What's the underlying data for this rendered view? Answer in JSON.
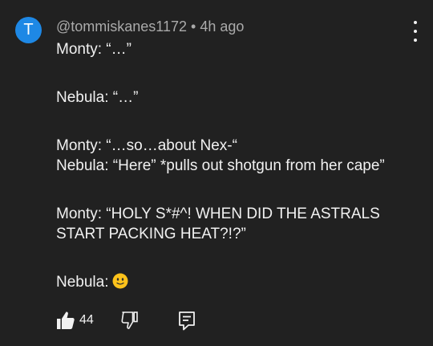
{
  "comment": {
    "avatar_letter": "T",
    "avatar_color": "#1e88e5",
    "author": "@tommiskanes1172",
    "separator": "•",
    "timestamp": "4h ago",
    "menu_icon": "more-vert-icon",
    "lines": [
      "Monty: “…”",
      "Nebula: “…”",
      "Monty: “…so…about Nex-“",
      "Nebula: “Here” *pulls out shotgun from her cape”",
      "Monty: “HOLY S*#^! WHEN DID THE ASTRALS",
      "START PACKING HEAT?!?”",
      "Nebula:"
    ],
    "last_line_emoji": "slightly-smiling-face-emoji"
  },
  "actions": {
    "like_icon": "thumbs-up-icon",
    "like_count": "44",
    "dislike_icon": "thumbs-down-icon",
    "reply_icon": "reply-icon"
  }
}
